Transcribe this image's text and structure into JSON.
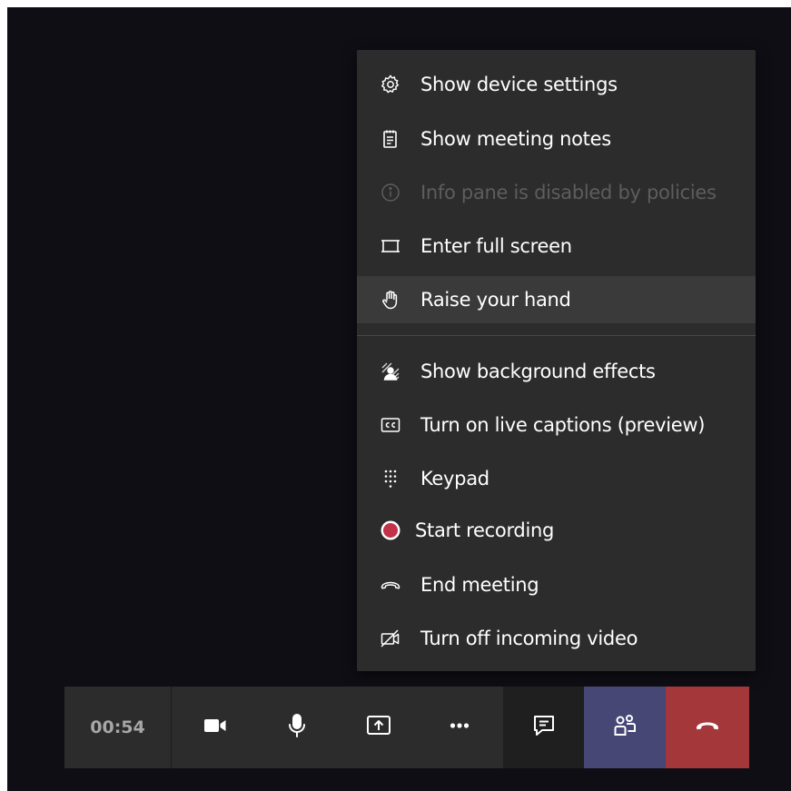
{
  "menu": {
    "items": [
      {
        "label": "Show device settings",
        "icon": "gear-icon",
        "disabled": false
      },
      {
        "label": "Show meeting notes",
        "icon": "notes-icon",
        "disabled": false
      },
      {
        "label": "Info pane is disabled by policies",
        "icon": "info-icon",
        "disabled": true
      },
      {
        "label": "Enter full screen",
        "icon": "fullscreen-icon",
        "disabled": false
      },
      {
        "label": "Raise your hand",
        "icon": "raise-hand-icon",
        "disabled": false,
        "hovered": true
      },
      {
        "label": "Show background effects",
        "icon": "background-effects-icon",
        "disabled": false
      },
      {
        "label": "Turn on live captions (preview)",
        "icon": "captions-icon",
        "disabled": false
      },
      {
        "label": "Keypad",
        "icon": "keypad-icon",
        "disabled": false
      },
      {
        "label": "Start recording",
        "icon": "record-icon",
        "disabled": false
      },
      {
        "label": "End meeting",
        "icon": "end-meeting-icon",
        "disabled": false
      },
      {
        "label": "Turn off incoming video",
        "icon": "video-off-icon",
        "disabled": false
      }
    ]
  },
  "call_bar": {
    "timer": "00:54",
    "buttons": [
      {
        "name": "camera",
        "icon": "camera-icon"
      },
      {
        "name": "microphone",
        "icon": "microphone-icon"
      },
      {
        "name": "share",
        "icon": "share-screen-icon"
      },
      {
        "name": "more-actions",
        "icon": "more-icon"
      },
      {
        "name": "chat",
        "icon": "chat-icon"
      },
      {
        "name": "participants",
        "icon": "people-icon"
      },
      {
        "name": "hang-up",
        "icon": "hang-up-icon"
      }
    ]
  },
  "colors": {
    "background": "#0f0e15",
    "menu_background": "#2d2c2c",
    "hover_background": "#3b3a3a",
    "disabled_text": "#5e5d5d",
    "participants_active": "#464775",
    "hang_up": "#a4373a",
    "record_red": "#c4314b"
  }
}
